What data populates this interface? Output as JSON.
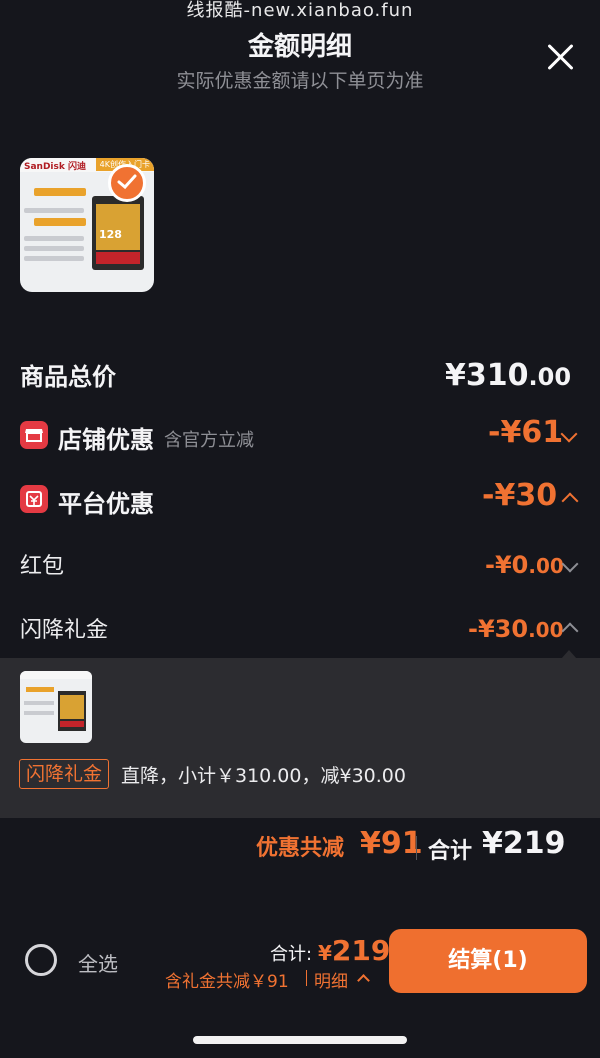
{
  "watermark": "线报酷-new.xianbao.fun",
  "header": {
    "title": "金额明细",
    "subtitle": "实际优惠金额请以下单页为准"
  },
  "product": {
    "brand": "SanDisk 闪迪",
    "tag": "4K创作入门卡",
    "capacity": "128"
  },
  "total_price": {
    "label": "商品总价",
    "currency": "¥",
    "main": "310",
    "decimal": ".00"
  },
  "store_discount": {
    "label": "店铺优惠",
    "note": "含官方立减",
    "value": "-¥61"
  },
  "platform_discount": {
    "label": "平台优惠",
    "value": "-¥30"
  },
  "red_packet": {
    "label": "红包",
    "value": "-¥0",
    "decimal": ".00"
  },
  "flash_gift": {
    "label": "闪降礼金",
    "value": "-¥30",
    "decimal": ".00"
  },
  "popover": {
    "tag": "闪降礼金",
    "text": "直降，小计￥310.00，减¥30.00"
  },
  "summary": {
    "discount_label": "优惠共减",
    "discount_value": "¥91",
    "total_label": "合计",
    "total_value": "¥219"
  },
  "footer": {
    "select_all": "全选",
    "total_label": "合计:",
    "total_currency": "¥",
    "total_value": "219",
    "gift_note": "含礼金共减￥91",
    "detail_link": "明细",
    "checkout": "结算(1)"
  },
  "colors": {
    "accent": "#f07232",
    "background": "#15161c",
    "popover": "#2c2c30",
    "shop_icon": "#e43a43"
  }
}
